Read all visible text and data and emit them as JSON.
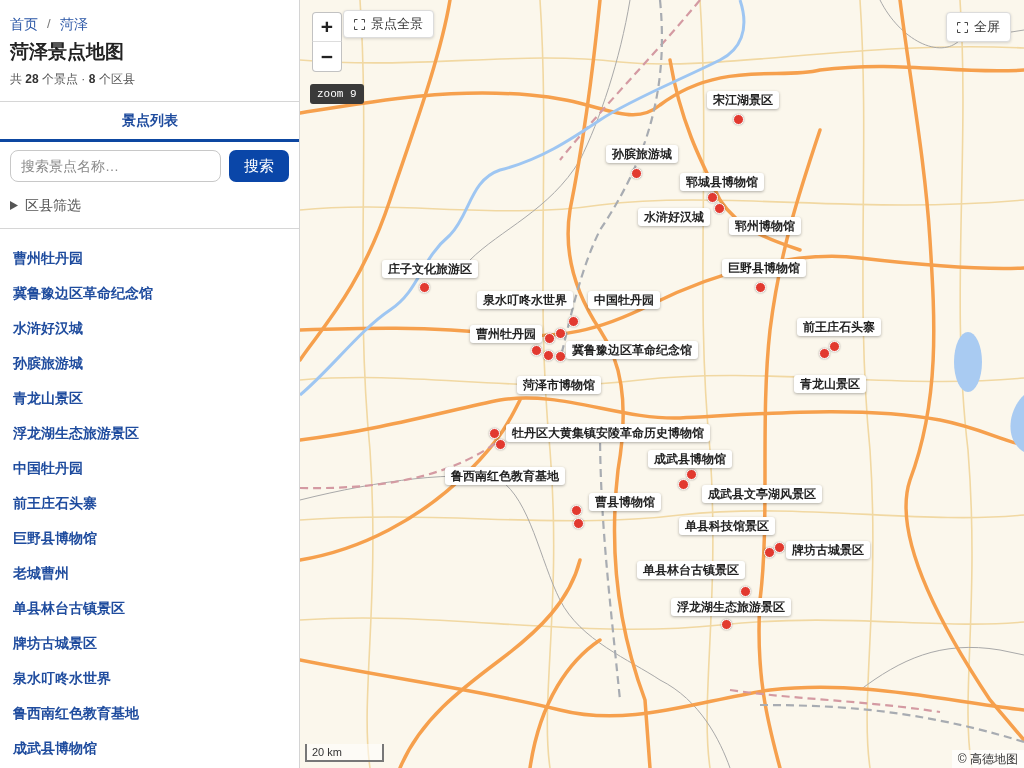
{
  "breadcrumb": {
    "items": [
      {
        "label": "首页"
      },
      {
        "label": "菏泽"
      }
    ],
    "separator": "/"
  },
  "title": "菏泽景点地图",
  "summary": "共 **28** 个景点 · **8** 个区县",
  "tabs": [
    {
      "label": "景点列表",
      "selected": true
    }
  ],
  "search": {
    "placeholder": "搜索景点名称…",
    "button": "搜索"
  },
  "filter": {
    "label": "区县筛选",
    "expanded": false
  },
  "spots": [
    "曹州牡丹园",
    "冀鲁豫边区革命纪念馆",
    "水浒好汉城",
    "孙膑旅游城",
    "青龙山景区",
    "浮龙湖生态旅游景区",
    "中国牡丹园",
    "前王庄石头寨",
    "巨野县博物馆",
    "老城曹州",
    "单县林台古镇景区",
    "牌坊古城景区",
    "泉水叮咚水世界",
    "鲁西南红色教育基地",
    "成武县博物馆"
  ],
  "map": {
    "zoom_in": "+",
    "zoom_out": "−",
    "overview_button": "景点全景",
    "fullscreen_button": "全屏",
    "zoom_badge": "zoom 9",
    "markers": [
      {
        "label": "宋江湖景区"
      },
      {
        "label": "孙膑旅游城"
      },
      {
        "label": "郓城县博物馆"
      },
      {
        "label": "水浒好汉城"
      },
      {
        "label": "郓州博物馆"
      },
      {
        "label": "庄子文化旅游区"
      },
      {
        "label": "巨野县博物馆"
      },
      {
        "label": "泉水叮咚水世界"
      },
      {
        "label": "中国牡丹园"
      },
      {
        "label": "前王庄石头寨"
      },
      {
        "label": "曹州牡丹园"
      },
      {
        "label": "冀鲁豫边区革命纪念馆"
      },
      {
        "label": "菏泽市博物馆"
      },
      {
        "label": "青龙山景区"
      },
      {
        "label": "牡丹区大黄集镇安陵革命历史博物馆"
      },
      {
        "label": "成武县博物馆"
      },
      {
        "label": "鲁西南红色教育基地"
      },
      {
        "label": "成武县文亭湖风景区"
      },
      {
        "label": "曹县博物馆"
      },
      {
        "label": "单县科技馆景区"
      },
      {
        "label": "牌坊古城景区"
      },
      {
        "label": "单县林台古镇景区"
      },
      {
        "label": "浮龙湖生态旅游景区"
      }
    ],
    "scale": "20 km",
    "attribution": "© 高德地图"
  }
}
